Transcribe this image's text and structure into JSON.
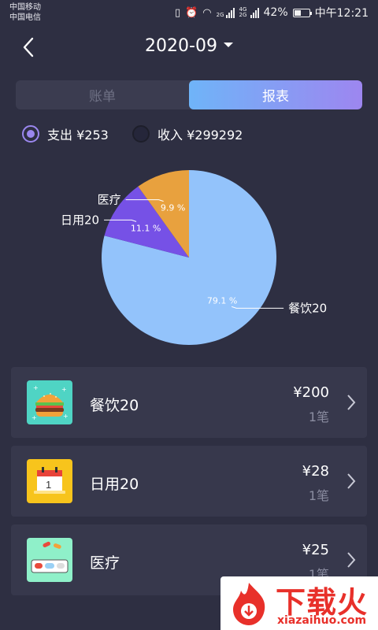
{
  "status": {
    "carrier1": "中国移动",
    "carrier2": "中国电信",
    "battery_pct": "42%",
    "battery_level": 0.42,
    "time": "中午12:21",
    "net1": "2G",
    "net2": "4G 2G"
  },
  "header": {
    "title": "2020-09"
  },
  "tabs": [
    {
      "label": "账单"
    },
    {
      "label": "报表"
    }
  ],
  "summary": {
    "expense_label": "支出 ¥253",
    "income_label": "收入 ¥299292"
  },
  "chart_data": {
    "type": "pie",
    "slices": [
      {
        "label": "餐饮20",
        "value": 79.1,
        "pct_label": "79.1 %",
        "color": "#93c3fb"
      },
      {
        "label": "日用20",
        "value": 11.1,
        "pct_label": "11.1 %",
        "color": "#7651e6"
      },
      {
        "label": "医疗",
        "value": 9.9,
        "pct_label": "9.9 %",
        "color": "#e8a13e"
      }
    ]
  },
  "records": [
    {
      "category": "餐饮20",
      "amount": "¥200",
      "count": "1笔",
      "icon": "burger-icon"
    },
    {
      "category": "日用20",
      "amount": "¥28",
      "count": "1笔",
      "icon": "calendar-icon"
    },
    {
      "category": "医疗",
      "amount": "¥25",
      "count": "1笔",
      "icon": "pills-icon"
    }
  ],
  "watermark": {
    "text": "下载火",
    "url": "xiazaihuo.com"
  }
}
